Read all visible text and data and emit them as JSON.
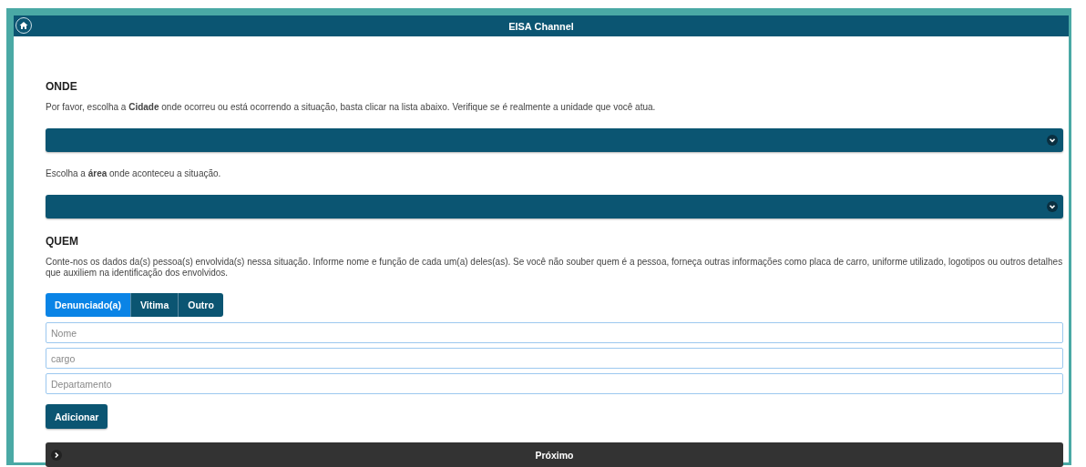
{
  "header": {
    "title": "EISA Channel"
  },
  "sections": [
    {
      "heading": "ONDE",
      "blocks": [
        {
          "kind": "text",
          "text": "Por favor, escolha a **Cidade** onde ocorreu ou está ocorrendo a situação, basta clicar na lista abaixo. Verifique se é realmente a unidade que você atua."
        },
        {
          "kind": "select"
        },
        {
          "kind": "text",
          "text": "Escolha a **área** onde aconteceu a situação."
        },
        {
          "kind": "select"
        }
      ]
    },
    {
      "heading": "QUEM",
      "blocks": [
        {
          "kind": "text",
          "text": "Conte-nos os dados da(s) pessoa(s) envolvida(s) nessa situação. Informe nome e função de cada um(a) deles(as). Se você não souber quem é a pessoa, forneça outras informações como placa de carro, uniforme utilizado, logotipos ou outros detalhes que auxiliem na identificação dos envolvidos."
        }
      ]
    }
  ],
  "tabs": [
    {
      "label": "Denunciado(a)",
      "selected": true
    },
    {
      "label": "Vitima",
      "selected": false
    },
    {
      "label": "Outro",
      "selected": false
    }
  ],
  "fields": [
    {
      "placeholder": "Nome"
    },
    {
      "placeholder": "cargo"
    },
    {
      "placeholder": "Departamento"
    }
  ],
  "add_button": "Adicionar",
  "next_bar": {
    "label": "Próximo"
  }
}
